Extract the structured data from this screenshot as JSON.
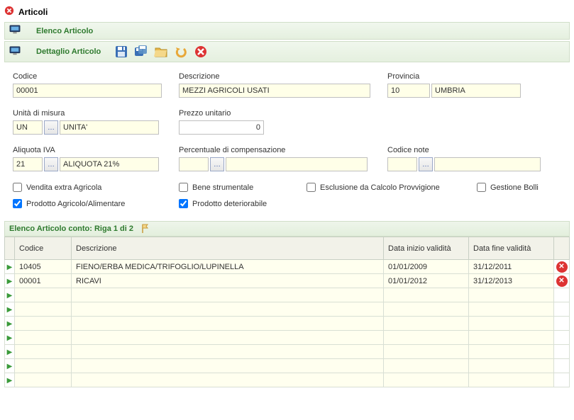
{
  "header": {
    "title": "Articoli"
  },
  "sections": {
    "elenco": "Elenco Articolo",
    "dettaglio": "Dettaglio Articolo"
  },
  "labels": {
    "codice": "Codice",
    "descrizione": "Descrizione",
    "provincia": "Provincia",
    "unita_misura": "Unità di misura",
    "prezzo_unitario": "Prezzo unitario",
    "aliquota_iva": "Aliquota IVA",
    "perc_comp": "Percentuale di compensazione",
    "codice_note": "Codice note"
  },
  "values": {
    "codice": "00001",
    "descrizione": "MEZZI AGRICOLI USATI",
    "provincia_code": "10",
    "provincia_name": "UMBRIA",
    "um_code": "UN",
    "um_name": "UNITA'",
    "prezzo": "0",
    "iva_code": "21",
    "iva_name": "ALIQUOTA 21%",
    "perc_comp_code": "",
    "perc_comp_name": "",
    "note_code": "",
    "note_name": ""
  },
  "checkboxes": {
    "vendita_extra": {
      "label": "Vendita extra Agricola",
      "checked": false
    },
    "bene_strumentale": {
      "label": "Bene strumentale",
      "checked": false
    },
    "esclusione_provv": {
      "label": "Esclusione da Calcolo Provvigione",
      "checked": false
    },
    "gestione_bolli": {
      "label": "Gestione Bolli",
      "checked": false
    },
    "prodotto_agricolo": {
      "label": "Prodotto Agricolo/Alimentare",
      "checked": true
    },
    "prodotto_deteriorabile": {
      "label": "Prodotto deteriorabile",
      "checked": true
    }
  },
  "table": {
    "title": "Elenco Articolo conto: Riga 1 di 2",
    "columns": {
      "codice": "Codice",
      "descrizione": "Descrizione",
      "data_inizio": "Data inizio validità",
      "data_fine": "Data fine validità"
    },
    "rows": [
      {
        "codice": "10405",
        "descrizione": "FIENO/ERBA MEDICA/TRIFOGLIO/LUPINELLA",
        "inizio": "01/01/2009",
        "fine": "31/12/2011",
        "deletable": true
      },
      {
        "codice": "00001",
        "descrizione": "RICAVI",
        "inizio": "01/01/2012",
        "fine": "31/12/2013",
        "deletable": true
      },
      {
        "codice": "",
        "descrizione": "",
        "inizio": "",
        "fine": "",
        "deletable": false
      },
      {
        "codice": "",
        "descrizione": "",
        "inizio": "",
        "fine": "",
        "deletable": false
      },
      {
        "codice": "",
        "descrizione": "",
        "inizio": "",
        "fine": "",
        "deletable": false
      },
      {
        "codice": "",
        "descrizione": "",
        "inizio": "",
        "fine": "",
        "deletable": false
      },
      {
        "codice": "",
        "descrizione": "",
        "inizio": "",
        "fine": "",
        "deletable": false
      },
      {
        "codice": "",
        "descrizione": "",
        "inizio": "",
        "fine": "",
        "deletable": false
      },
      {
        "codice": "",
        "descrizione": "",
        "inizio": "",
        "fine": "",
        "deletable": false
      }
    ]
  },
  "icons": {
    "save": "save-icon",
    "save_as": "save-as-icon",
    "open": "open-folder-icon",
    "undo": "undo-icon",
    "close": "close-round-icon"
  }
}
